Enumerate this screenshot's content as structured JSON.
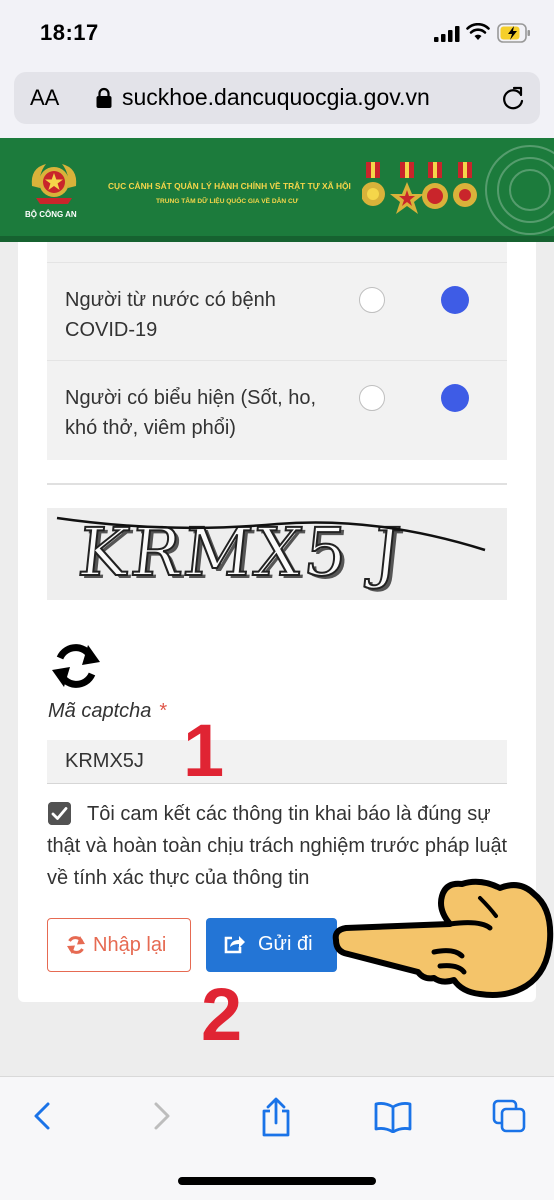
{
  "status": {
    "time": "18:17"
  },
  "browser": {
    "aa_label": "AA",
    "url": "suckhoe.dancuquocgia.gov.vn"
  },
  "banner": {
    "emblem_caption": "BỘ CÔNG AN",
    "line1": "CỤC CẢNH SÁT QUẢN LÝ HÀNH CHÍNH VỀ TRẬT TỰ XÃ HỘI",
    "line2": "TRUNG TÂM DỮ LIỆU QUỐC GIA VỀ DÂN CƯ"
  },
  "form": {
    "questions": [
      {
        "text": "Người từ nước có bệnh COVID-19",
        "answer": "second-option-selected"
      },
      {
        "text": "Người có biểu hiện (Sốt, ho, khó thở, viêm phổi)",
        "answer": "second-option-selected"
      }
    ],
    "captcha_image_text": "KRMX5 J",
    "captcha_label": "Mã captcha",
    "required_mark": "*",
    "captcha_value": "KRMX5J",
    "commit_checked": true,
    "commit_text": "Tôi cam kết các thông tin khai báo là đúng sự thật và hoàn toàn chịu trách nghiệm trước pháp luật về tính xác thực của thông tin",
    "reset_label": "Nhập lại",
    "submit_label": "Gửi đi"
  },
  "annotations": {
    "step1": "1",
    "step2": "2"
  },
  "colors": {
    "banner_green": "#1c7b3c",
    "radio_selected": "#3e5ce6",
    "submit_blue": "#2375d6",
    "reset_orange": "#e66a52",
    "annotation_red": "#e02433"
  },
  "icons": [
    "signal-icon",
    "wifi-icon",
    "battery-charging-icon",
    "lock-icon",
    "reload-icon",
    "refresh-captcha-icon",
    "checkbox-checked-icon",
    "reset-icon",
    "share-send-icon",
    "pointing-hand-icon",
    "back-icon",
    "forward-icon",
    "share-icon",
    "bookmarks-icon",
    "tabs-icon"
  ]
}
